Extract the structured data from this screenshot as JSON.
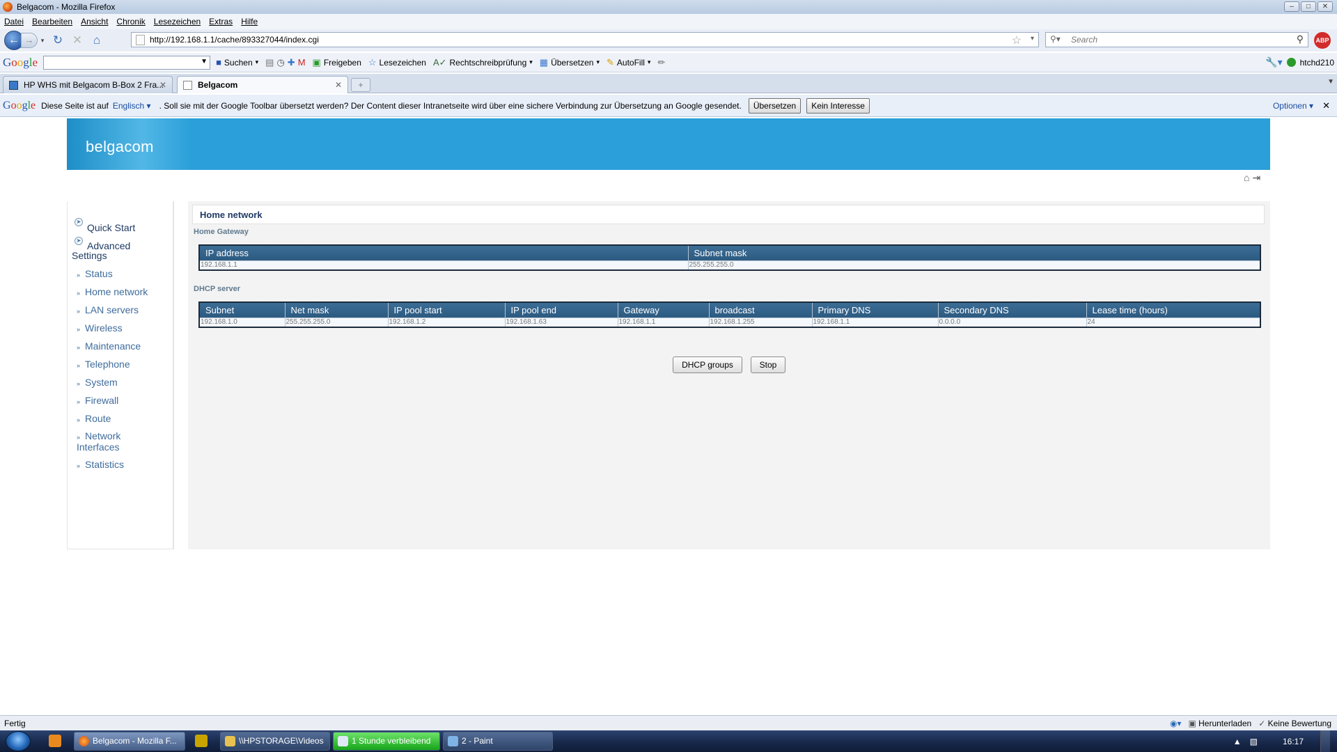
{
  "window": {
    "title": "Belgacom - Mozilla Firefox",
    "min": "–",
    "max": "□",
    "close": "✕"
  },
  "menu": [
    "Datei",
    "Bearbeiten",
    "Ansicht",
    "Chronik",
    "Lesezeichen",
    "Extras",
    "Hilfe"
  ],
  "nav": {
    "url": "http://192.168.1.1/cache/893327044/index.cgi",
    "search_placeholder": "Search",
    "abp": "ABP"
  },
  "google_toolbar": {
    "logo": "Google",
    "items": [
      "Suchen",
      "Freigeben",
      "Lesezeichen",
      "Rechtschreibprüfung",
      "Übersetzen",
      "AutoFill"
    ],
    "user": "htchd210"
  },
  "tabs": [
    {
      "label": "HP WHS mit Belgacom B-Box 2 Fra...",
      "active": false
    },
    {
      "label": "Belgacom",
      "active": true
    }
  ],
  "translate_bar": {
    "prefix": "Diese Seite ist auf",
    "language": "Englisch",
    "message": ". Soll sie mit der Google Toolbar übersetzt werden? Der Content dieser Intranetseite wird über eine sichere Verbindung zur Übersetzung an Google gesendet.",
    "translate_btn": "Übersetzen",
    "dismiss_btn": "Kein Interesse",
    "options": "Optionen"
  },
  "brand": {
    "logo": "belgacom",
    "color": "#2a9fd9"
  },
  "sidebar": {
    "main": [
      {
        "label": "Quick Start"
      },
      {
        "label": "Advanced Settings"
      }
    ],
    "sub": [
      "Status",
      "Home network",
      "LAN servers",
      "Wireless",
      "Maintenance",
      "Telephone",
      "System",
      "Firewall",
      "Route",
      "Network Interfaces",
      "Statistics"
    ]
  },
  "page": {
    "title": "Home network",
    "gateway_label": "Home Gateway",
    "gateway_table": {
      "headers": [
        "IP address",
        "Subnet mask"
      ],
      "row": [
        "192.168.1.1",
        "255.255.255.0"
      ]
    },
    "dhcp_label": "DHCP server",
    "dhcp_table": {
      "headers": [
        "Subnet",
        "Net mask",
        "IP pool start",
        "IP pool end",
        "Gateway",
        "broadcast",
        "Primary DNS",
        "Secondary DNS",
        "Lease time (hours)"
      ],
      "row": [
        "192.168.1.0",
        "255.255.255.0",
        "192.168.1.2",
        "192.168.1.63",
        "192.168.1.1",
        "192.168.1.255",
        "192.168.1.1",
        "0.0.0.0",
        "24"
      ]
    },
    "buttons": {
      "dhcp_groups": "DHCP groups",
      "stop": "Stop"
    }
  },
  "statusbar": {
    "text": "Fertig",
    "download": "Herunterladen",
    "rating": "Keine Bewertung"
  },
  "taskbar": {
    "items": [
      "Belgacom - Mozilla F...",
      "\\\\HPSTORAGE\\Videos",
      "1 Stunde verbleibend",
      "2 - Paint"
    ],
    "clock": "16:17"
  }
}
